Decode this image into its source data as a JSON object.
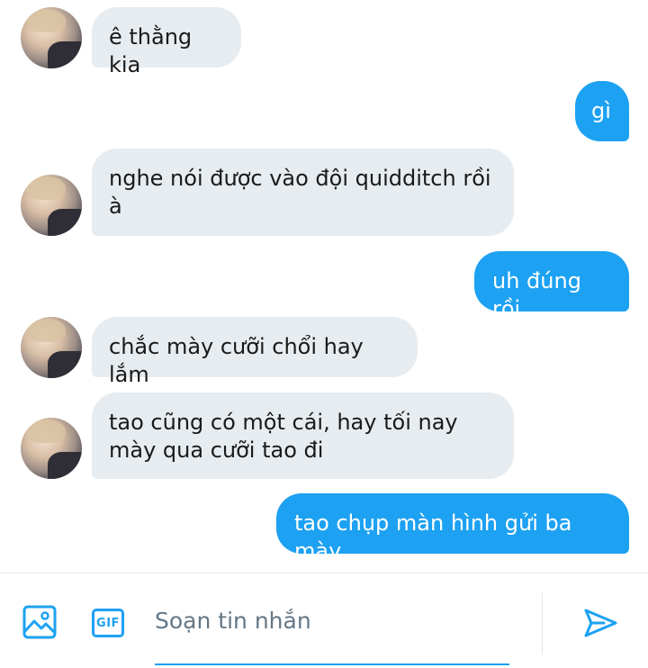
{
  "messages": [
    {
      "direction": "in",
      "text": "ê thằng kia"
    },
    {
      "direction": "out",
      "text": "gì"
    },
    {
      "direction": "in",
      "text": "nghe nói được vào đội quidditch rồi à"
    },
    {
      "direction": "out",
      "text": "uh đúng rồi"
    },
    {
      "direction": "in",
      "text": "chắc mày cưỡi chổi hay lắm"
    },
    {
      "direction": "in",
      "text": "tao cũng có một cái, hay tối nay mày qua cưỡi tao đi"
    },
    {
      "direction": "out",
      "text": "tao chụp màn hình gửi ba mày"
    }
  ],
  "composer": {
    "placeholder": "Soạn tin nhắn",
    "value": "",
    "gif_label": "GIF"
  },
  "icons": {
    "media": "image-icon",
    "gif": "gif-icon",
    "send": "send-icon"
  },
  "colors": {
    "accent": "#1da1f2",
    "incoming_bubble": "#e6ecf0",
    "outgoing_text": "#ffffff"
  }
}
